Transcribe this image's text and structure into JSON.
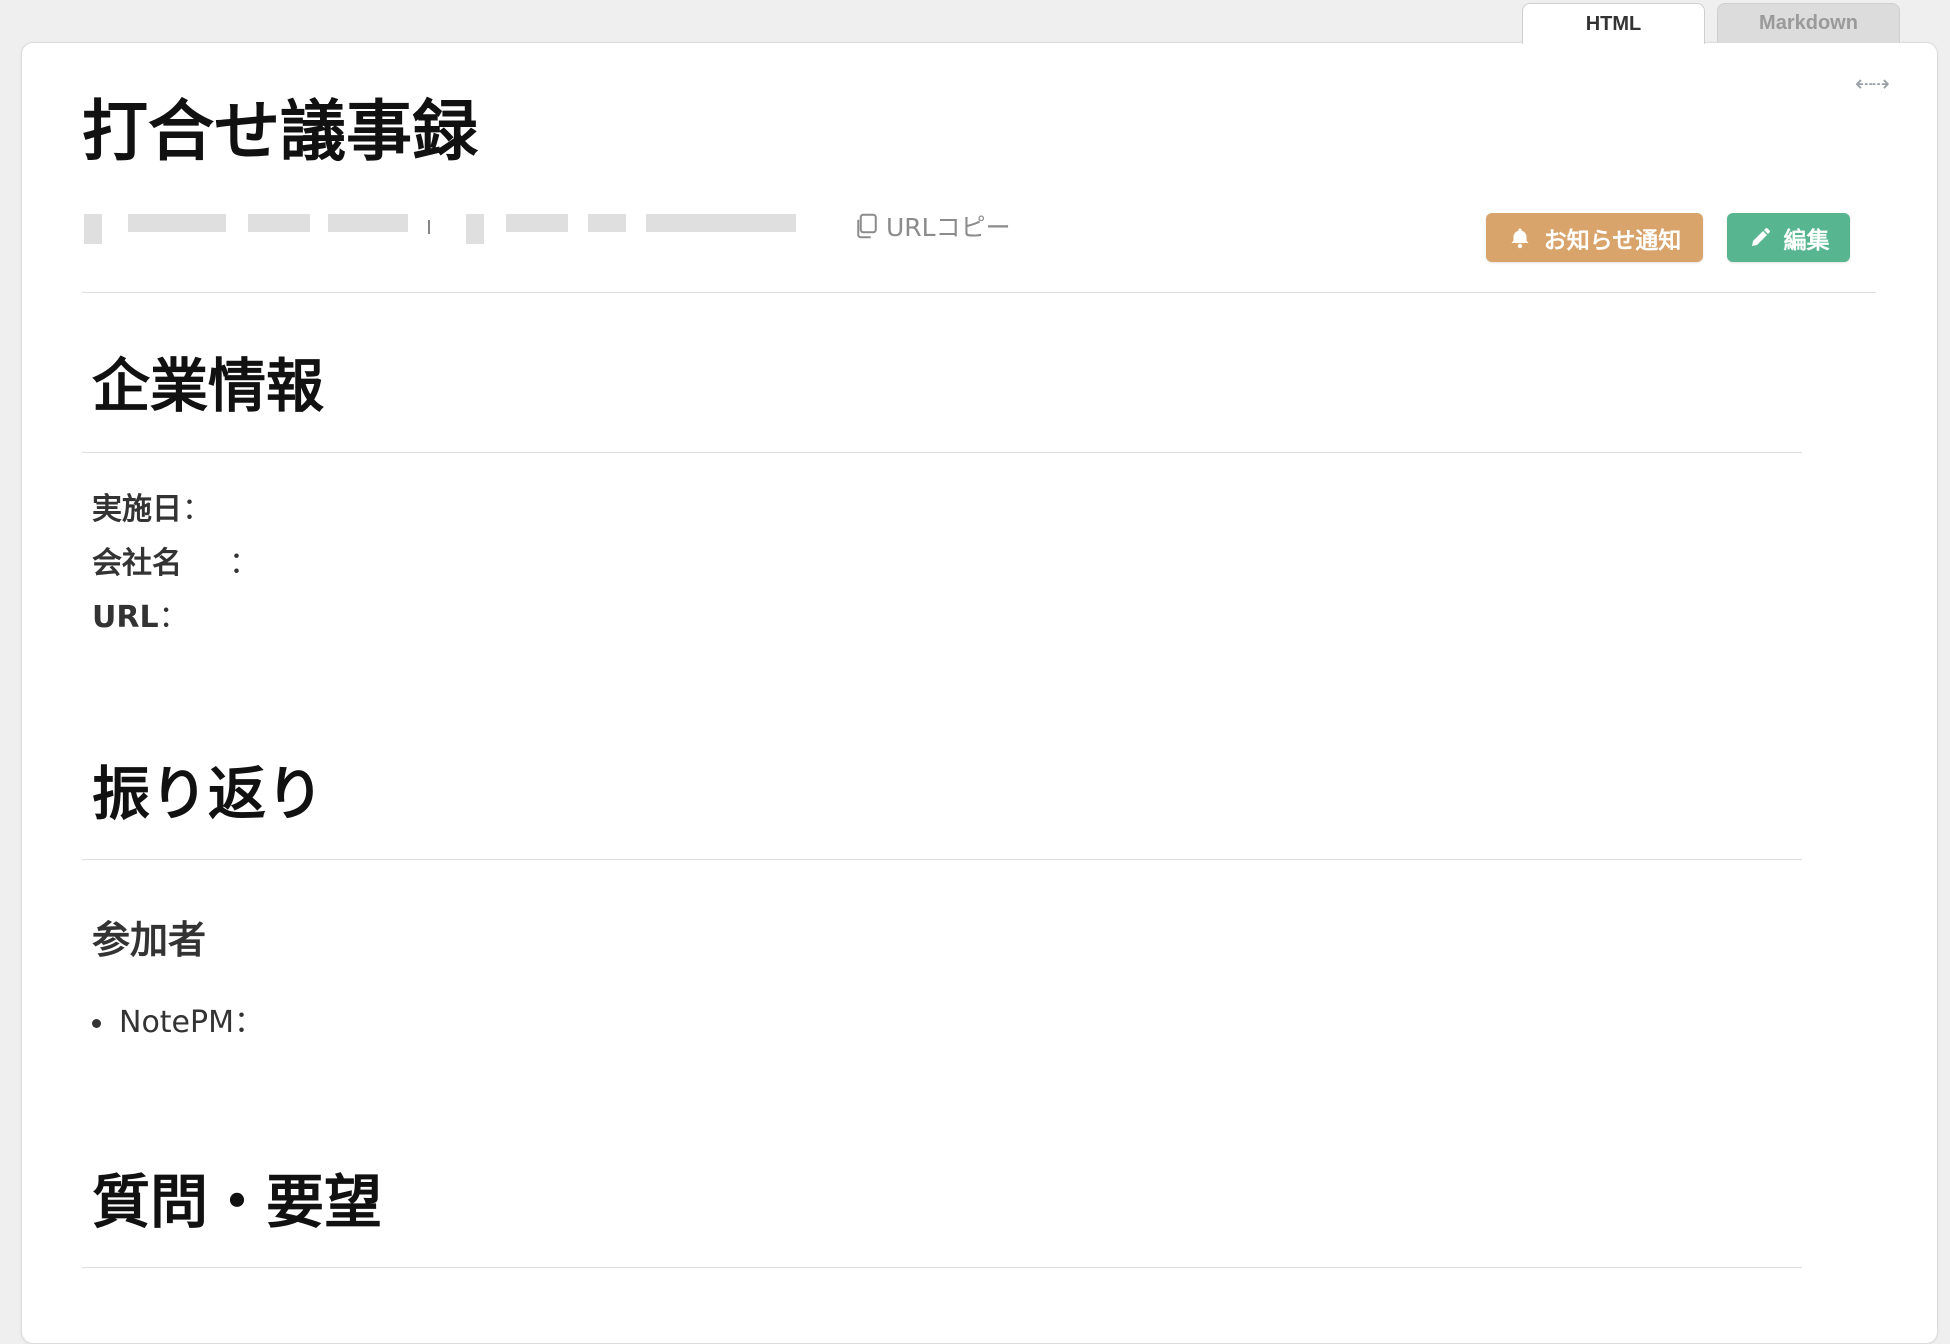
{
  "tabs": [
    {
      "label": "HTML",
      "active": true
    },
    {
      "label": "Markdown",
      "active": false
    }
  ],
  "page": {
    "title": "打合せ議事録",
    "copy_url_label": "URLコピー",
    "actions": {
      "notify_label": "お知らせ通知",
      "edit_label": "編集"
    }
  },
  "sections": {
    "company": {
      "heading": "企業情報",
      "fields": {
        "date_label": "実施日",
        "company_label": "会社名",
        "url_label": "URL",
        "separator": "："
      }
    },
    "review": {
      "heading": "振り返り",
      "participants": {
        "heading": "参加者",
        "items": [
          "NotePM："
        ]
      }
    },
    "questions": {
      "heading": "質問・要望"
    }
  },
  "colors": {
    "notify_button": "#d9a46c",
    "edit_button": "#57b690",
    "icon_muted": "#9aa0a6"
  },
  "icons": {
    "expand": "expand-horizontal-icon",
    "copy": "copy-icon",
    "bell": "bell-icon",
    "pencil": "pencil-icon"
  }
}
